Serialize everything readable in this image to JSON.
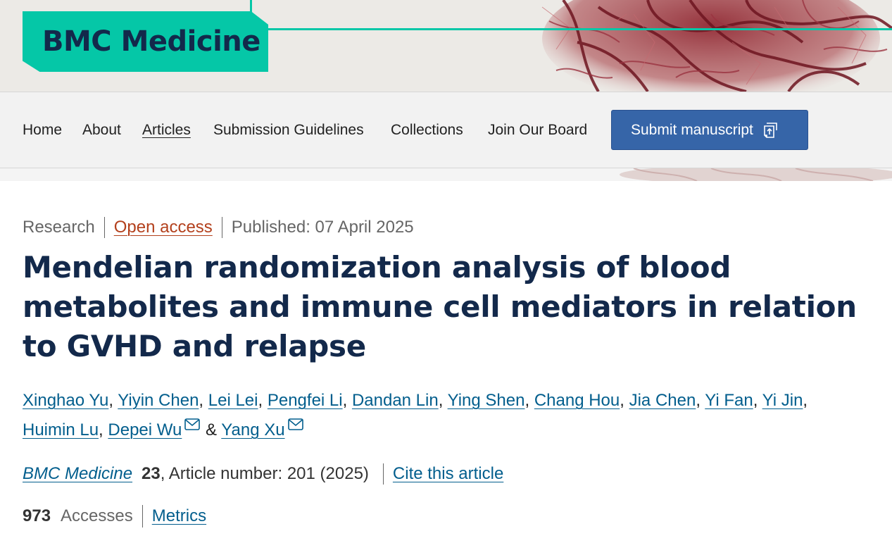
{
  "brand": {
    "journal_name": "BMC Medicine",
    "accent_color": "#05c7a7",
    "navy_color": "#13294b",
    "link_color": "#025e8d"
  },
  "nav": {
    "items": [
      {
        "label": "Home",
        "active": false
      },
      {
        "label": "About",
        "active": false
      },
      {
        "label": "Articles",
        "active": true
      },
      {
        "label": "Submission Guidelines",
        "active": false
      },
      {
        "label": "Collections",
        "active": false
      },
      {
        "label": "Join Our Board",
        "active": false
      }
    ],
    "submit_label": "Submit manuscript",
    "submit_icon": "external-submit-icon"
  },
  "article": {
    "type": "Research",
    "access": "Open access",
    "published": "Published: 07 April 2025",
    "title": "Mendelian randomization analysis of blood metabolites and immune cell mediators in relation to GVHD and relapse",
    "authors": [
      {
        "name": "Xinghao Yu",
        "corresponding": false
      },
      {
        "name": "Yiyin Chen",
        "corresponding": false
      },
      {
        "name": "Lei Lei",
        "corresponding": false
      },
      {
        "name": "Pengfei Li",
        "corresponding": false
      },
      {
        "name": "Dandan Lin",
        "corresponding": false
      },
      {
        "name": "Ying Shen",
        "corresponding": false
      },
      {
        "name": "Chang Hou",
        "corresponding": false
      },
      {
        "name": "Jia Chen",
        "corresponding": false
      },
      {
        "name": "Yi Fan",
        "corresponding": false
      },
      {
        "name": "Yi Jin",
        "corresponding": false
      },
      {
        "name": "Huimin Lu",
        "corresponding": false
      },
      {
        "name": "Depei Wu",
        "corresponding": true
      },
      {
        "name": "Yang Xu",
        "corresponding": true
      }
    ],
    "journal_ref": "BMC Medicine",
    "volume": "23",
    "article_number_text": ", Article number: 201 (2025)",
    "cite_label": "Cite this article",
    "accesses_count": "973",
    "accesses_label": "Accesses",
    "metrics_label": "Metrics"
  }
}
